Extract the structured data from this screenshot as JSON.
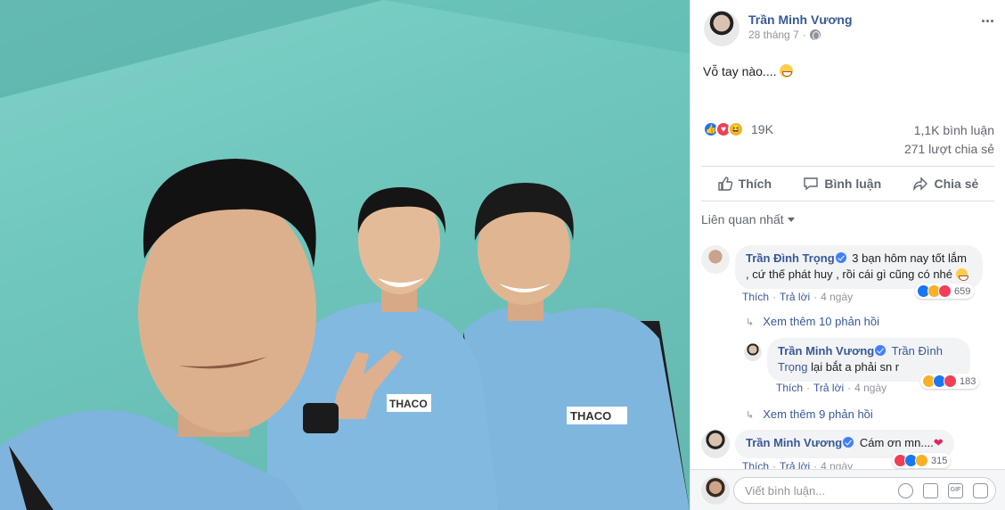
{
  "post": {
    "author": "Trần Minh Vương",
    "date": "28 tháng 7",
    "text": "Vỗ tay nào....",
    "reaction_count": "19K",
    "comment_count": "1,1K bình luận",
    "share_count": "271 lượt chia sẻ"
  },
  "actions": {
    "like": "Thích",
    "comment": "Bình luận",
    "share": "Chia sẻ"
  },
  "sort_label": "Liên quan nhất",
  "comments": [
    {
      "name": "Trần Đình Trọng",
      "text": "3 bạn hôm nay tốt lắm , cứ thế phát huy , rồi cái gì cũng có nhé",
      "like": "Thích",
      "reply": "Trả lời",
      "time": "4 ngày",
      "reactions": "659"
    },
    {
      "name": "Trần Minh Vương",
      "mention": "Trần Đình Trọng",
      "text": "lại bắt a phải sn r",
      "like": "Thích",
      "reply": "Trả lời",
      "time": "4 ngày",
      "reactions": "183"
    },
    {
      "name": "Trần Minh Vương",
      "text": "Cám ơn mn....",
      "like": "Thích",
      "reply": "Trả lời",
      "time": "4 ngày",
      "reactions": "315"
    }
  ],
  "more_replies_1": "Xem thêm 10 phản hồi",
  "more_replies_2": "Xem thêm 9 phản hồi",
  "composer": {
    "placeholder": "Viết bình luận..."
  },
  "colors": {
    "link": "#385898",
    "like": "#1877f2",
    "love": "#f33e58",
    "haha": "#f7b125",
    "wall": "#6fc6bd",
    "shirt": "#7fb6de"
  },
  "icons": [
    "more-icon",
    "globe-icon",
    "like-icon",
    "love-icon",
    "haha-icon",
    "comment-icon",
    "share-icon",
    "verified-icon",
    "emoji-icon",
    "camera-icon",
    "gif-icon",
    "sticker-icon"
  ]
}
